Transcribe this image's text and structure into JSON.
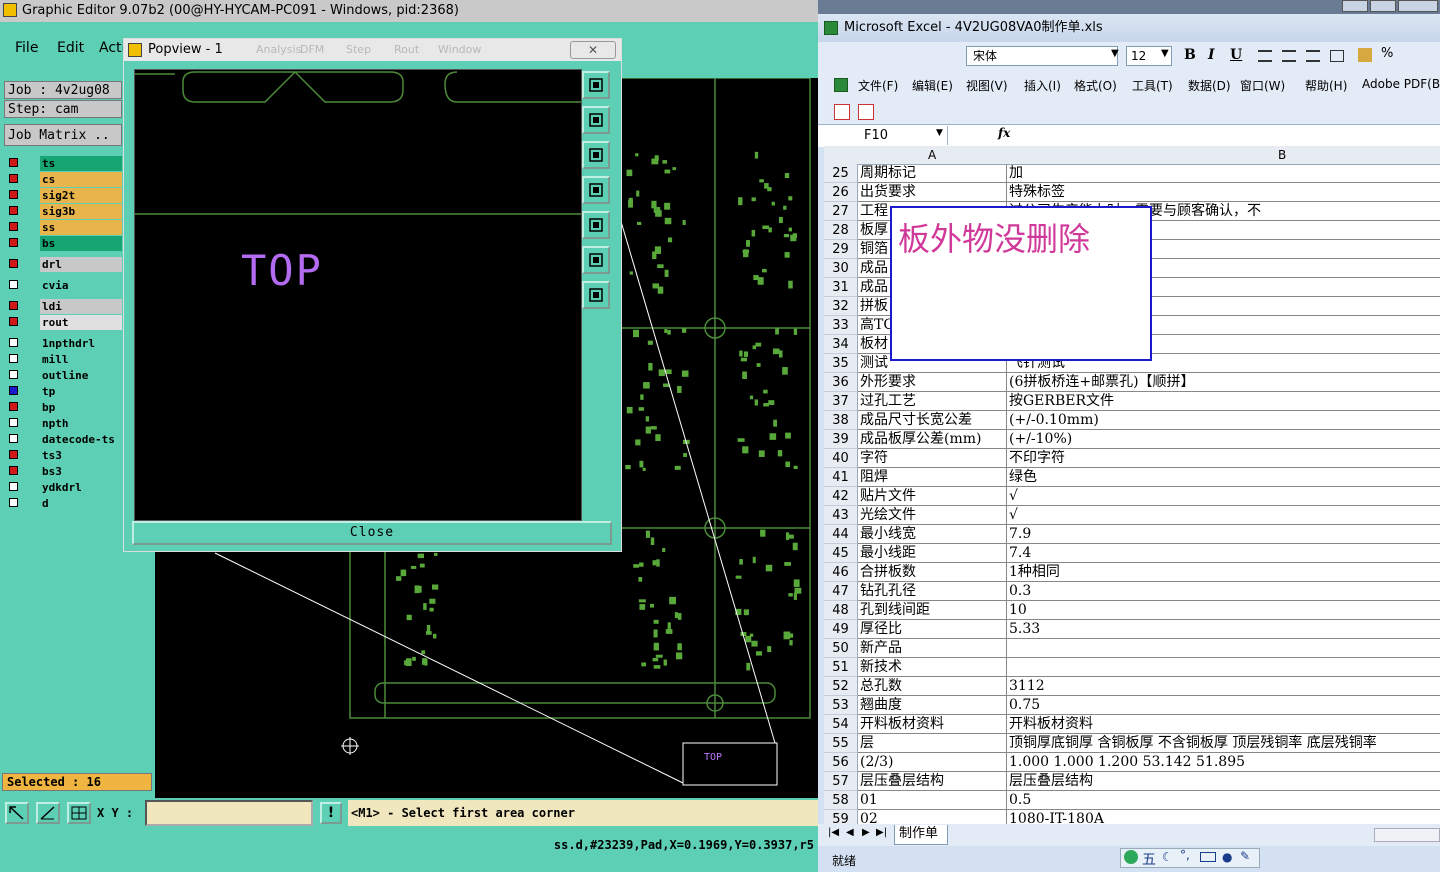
{
  "cam": {
    "title": "Graphic Editor 9.07b2 (00@HY-HYCAM-PC091 - Windows, pid:2368)",
    "menus": [
      "File",
      "Edit",
      "Acti"
    ],
    "job": "Job : 4v2ug08",
    "step": "Step: cam",
    "job_matrix": "Job Matrix ..",
    "layers": [
      {
        "name": "ts",
        "box": "#d01818",
        "bg": "#17a673"
      },
      {
        "name": "cs",
        "box": "#d01818",
        "bg": "#e8b54d"
      },
      {
        "name": "sig2t",
        "box": "#d01818",
        "bg": "#e8b54d"
      },
      {
        "name": "sig3b",
        "box": "#d01818",
        "bg": "#e8b54d"
      },
      {
        "name": "ss",
        "box": "#d01818",
        "bg": "#e8b54d"
      },
      {
        "name": "bs",
        "box": "#d01818",
        "bg": "#17a673"
      },
      {
        "name": "drl",
        "box": "#d01818",
        "bg": "#c8c8c8"
      },
      {
        "name": "cvia",
        "box": "#ffffff",
        "bg": "#5ccfb4"
      },
      {
        "name": "ldi",
        "box": "#d01818",
        "bg": "#c8c8c8"
      },
      {
        "name": "rout",
        "box": "#d01818",
        "bg": "#e0e0e0"
      },
      {
        "name": "1npthdrl",
        "box": "#ffffff",
        "bg": "#5ccfb4"
      },
      {
        "name": "mill",
        "box": "#ffffff",
        "bg": "#5ccfb4"
      },
      {
        "name": "outline",
        "box": "#ffffff",
        "bg": "#5ccfb4"
      },
      {
        "name": "tp",
        "box": "#1a1acc",
        "bg": "#5ccfb4"
      },
      {
        "name": "bp",
        "box": "#d01818",
        "bg": "#5ccfb4"
      },
      {
        "name": "npth",
        "box": "#ffffff",
        "bg": "#5ccfb4"
      },
      {
        "name": "datecode-ts",
        "box": "#ffffff",
        "bg": "#5ccfb4"
      },
      {
        "name": "ts3",
        "box": "#d01818",
        "bg": "#5ccfb4"
      },
      {
        "name": "bs3",
        "box": "#d01818",
        "bg": "#5ccfb4"
      },
      {
        "name": "ydkdrl",
        "box": "#ffffff",
        "bg": "#5ccfb4"
      },
      {
        "name": "d",
        "box": "#ffffff",
        "bg": "#5ccfb4"
      }
    ],
    "selected": "Selected : 16",
    "xy_label": "X Y :",
    "prompt": "<M1> - Select first area corner",
    "status": "ss.d,#23239,Pad,X=0.1969,Y=0.3937,r5",
    "board_label": "TOP"
  },
  "popview": {
    "title": "Popview - 1",
    "title_ghost": [
      "Analysis",
      "DFM",
      "Step",
      "Rout",
      "Window"
    ],
    "canvas_text": "TOP",
    "close_label": "Close",
    "tool_icons": [
      "zoom-page-icon",
      "pan-up-icon",
      "pan-down-icon",
      "pan-left-icon",
      "pan-right-icon",
      "zoom-fit-icon",
      "zoom-home-icon"
    ]
  },
  "excel": {
    "title": "Microsoft Excel - 4V2UG08VA0制作单.xls",
    "font_name": "宋体",
    "font_size": "12",
    "menus": [
      "文件(F)",
      "编辑(E)",
      "视图(V)",
      "插入(I)",
      "格式(O)",
      "工具(T)",
      "数据(D)",
      "窗口(W)",
      "帮助(H)",
      "Adobe PDF(B)"
    ],
    "name_box": "F10",
    "fx": "fx",
    "col_a": "A",
    "col_b": "B",
    "rows": [
      {
        "n": "25",
        "a": "周期标记",
        "b": "加"
      },
      {
        "n": "26",
        "a": "出货要求",
        "b": "特殊标签"
      },
      {
        "n": "27",
        "a": "工程",
        "b": "过公司生产能力时，需要与顾客确认，不"
      },
      {
        "n": "28",
        "a": "板厚",
        "b": ""
      },
      {
        "n": "29",
        "a": "铜箔",
        "b": ""
      },
      {
        "n": "30",
        "a": "成品",
        "b": ""
      },
      {
        "n": "31",
        "a": "成品",
        "b": ""
      },
      {
        "n": "32",
        "a": "拼板",
        "b": ""
      },
      {
        "n": "33",
        "a": "高TG",
        "b": ""
      },
      {
        "n": "34",
        "a": "板材",
        "b": ""
      },
      {
        "n": "35",
        "a": "测试",
        "b": "飞针测试"
      },
      {
        "n": "36",
        "a": "外形要求",
        "b": "(6拼板桥连+邮票孔)【顺拼】"
      },
      {
        "n": "37",
        "a": "过孔工艺",
        "b": "按GERBER文件"
      },
      {
        "n": "38",
        "a": "成品尺寸长宽公差",
        "b": "(+/-0.10mm)"
      },
      {
        "n": "39",
        "a": "成品板厚公差(mm)",
        "b": "(+/-10%)"
      },
      {
        "n": "40",
        "a": "字符",
        "b": "不印字符"
      },
      {
        "n": "41",
        "a": "阻焊",
        "b": "绿色"
      },
      {
        "n": "42",
        "a": "贴片文件",
        "b": "√"
      },
      {
        "n": "43",
        "a": "光绘文件",
        "b": "√"
      },
      {
        "n": "44",
        "a": "最小线宽",
        "b": "7.9"
      },
      {
        "n": "45",
        "a": "最小线距",
        "b": "7.4"
      },
      {
        "n": "46",
        "a": "合拼板数",
        "b": "1种相同"
      },
      {
        "n": "47",
        "a": "钻孔孔径",
        "b": "0.3"
      },
      {
        "n": "48",
        "a": "孔到线间距",
        "b": "10"
      },
      {
        "n": "49",
        "a": "厚径比",
        "b": "5.33"
      },
      {
        "n": "50",
        "a": "新产品",
        "b": ""
      },
      {
        "n": "51",
        "a": "新技术",
        "b": ""
      },
      {
        "n": "52",
        "a": "总孔数",
        "b": "3112"
      },
      {
        "n": "53",
        "a": "翘曲度",
        "b": "0.75"
      },
      {
        "n": "54",
        "a": "开料板材资料",
        "b": "开料板材资料"
      },
      {
        "n": "55",
        "a": "层",
        "b": "顶铜厚底铜厚 含铜板厚 不含铜板厚 顶层残铜率 底层残铜率"
      },
      {
        "n": "56",
        "a": "(2/3)",
        "b": "1.000  1.000   1.200             53.142    51.895"
      },
      {
        "n": "57",
        "a": "层压叠层结构",
        "b": "层压叠层结构"
      },
      {
        "n": "58",
        "a": "01",
        "b": "0.5"
      },
      {
        "n": "59",
        "a": "02",
        "b": "1080-IT-180A"
      }
    ],
    "comment": "板外物没删除",
    "sheet_tab": "制作单",
    "status": "就绪",
    "ime_label": "五"
  }
}
